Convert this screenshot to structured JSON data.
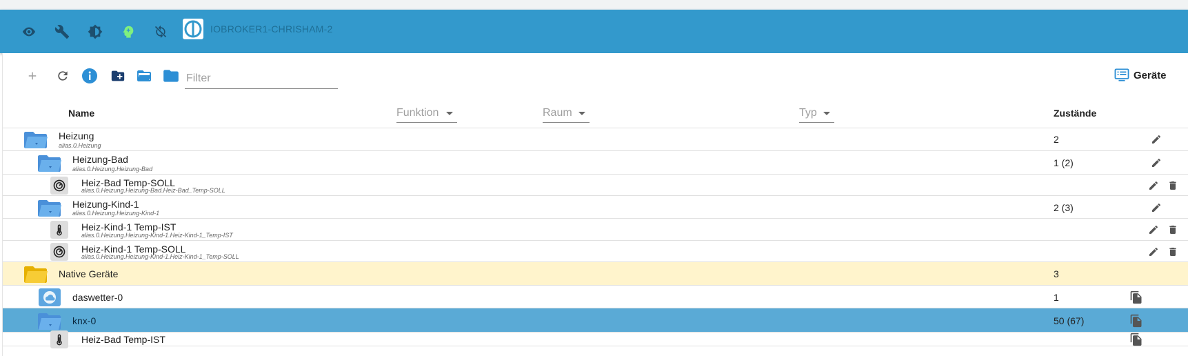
{
  "appbar": {
    "title": "IOBROKER1-CHRISHAM-2",
    "icons": [
      "eye-icon",
      "wrench-icon",
      "brightness-icon",
      "head-icon",
      "sync-icon"
    ]
  },
  "toolbar": {
    "filter_placeholder": "Filter",
    "devices_label": "Geräte",
    "icons": [
      "add-icon",
      "refresh-icon",
      "info-icon",
      "new-folder-icon",
      "open-folder-icon",
      "folder-icon"
    ]
  },
  "table": {
    "headers": {
      "name": "Name",
      "function": "Funktion",
      "room": "Raum",
      "type": "Typ",
      "states": "Zustände"
    },
    "rows": [
      {
        "name": "Heizung",
        "id": "alias.0.Heizung",
        "states": "2",
        "kind": "folder-blue",
        "level": 0,
        "actions": [
          "edit"
        ]
      },
      {
        "name": "Heizung-Bad",
        "id": "alias.0.Heizung.Heizung-Bad",
        "states": "1 (2)",
        "kind": "folder-blue",
        "level": 1,
        "actions": [
          "edit"
        ]
      },
      {
        "name": "Heiz-Bad Temp-SOLL",
        "id": "alias.0.Heizung.Heizung-Bad.Heiz-Bad_Temp-SOLL",
        "states": "",
        "kind": "thermostat",
        "level": 2,
        "actions": [
          "edit",
          "delete"
        ]
      },
      {
        "name": "Heizung-Kind-1",
        "id": "alias.0.Heizung.Heizung-Kind-1",
        "states": "2 (3)",
        "kind": "folder-blue",
        "level": 1,
        "actions": [
          "edit"
        ]
      },
      {
        "name": "Heiz-Kind-1 Temp-IST",
        "id": "alias.0.Heizung.Heizung-Kind-1.Heiz-Kind-1_Temp-IST",
        "states": "",
        "kind": "thermometer",
        "level": 2,
        "actions": [
          "edit",
          "delete"
        ]
      },
      {
        "name": "Heiz-Kind-1 Temp-SOLL",
        "id": "alias.0.Heizung.Heizung-Kind-1.Heiz-Kind-1_Temp-SOLL",
        "states": "",
        "kind": "thermostat",
        "level": 2,
        "actions": [
          "edit",
          "delete"
        ]
      },
      {
        "name": "Native Geräte",
        "id": "",
        "states": "3",
        "kind": "folder-yellow",
        "level": 0,
        "actions": []
      },
      {
        "name": "daswetter-0",
        "id": "",
        "states": "1",
        "kind": "weather",
        "level": 1,
        "actions": [
          "copy"
        ]
      },
      {
        "name": "knx-0",
        "id": "",
        "states": "50 (67)",
        "kind": "folder-blue",
        "level": 1,
        "actions": [
          "copy"
        ]
      },
      {
        "name": "Heiz-Bad Temp-IST",
        "id": "",
        "states": "",
        "kind": "thermometer",
        "level": 2,
        "actions": [
          "copy"
        ]
      }
    ]
  },
  "colors": {
    "appbar": "#3399cc",
    "accent": "#3399cc",
    "folder_blue": "#3a8fd9",
    "folder_yellow": "#f5c518",
    "selected_row": "#5aaad6",
    "highlight_row": "#fff4cc"
  }
}
